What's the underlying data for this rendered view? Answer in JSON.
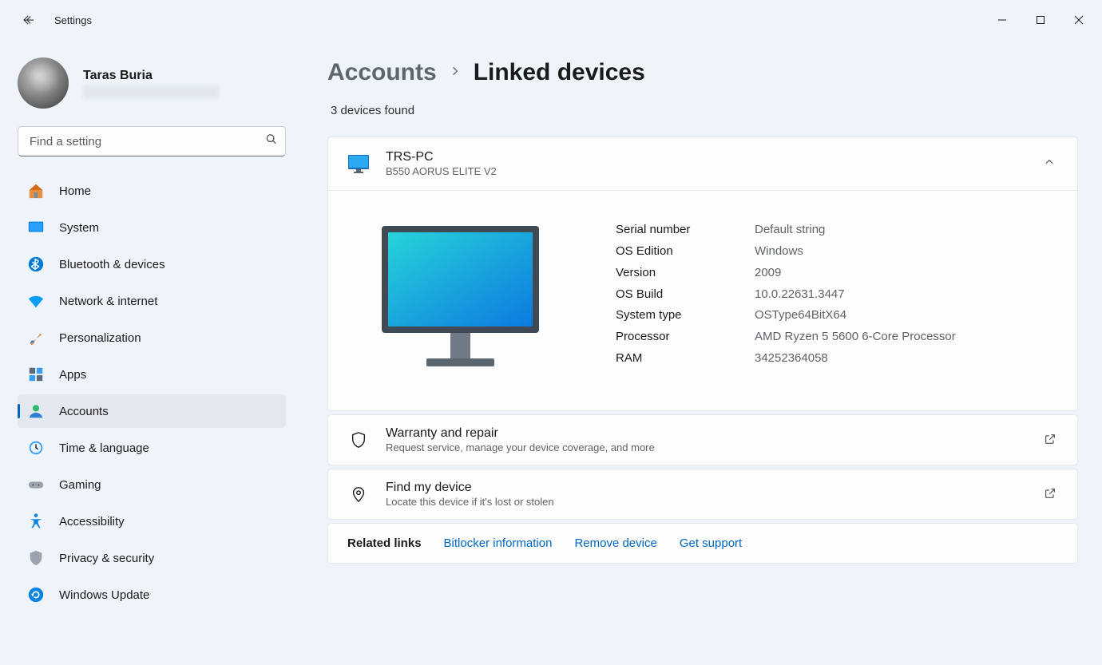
{
  "titlebar": {
    "title": "Settings"
  },
  "profile": {
    "name": "Taras Buria"
  },
  "search": {
    "placeholder": "Find a setting"
  },
  "nav": {
    "items": [
      {
        "label": "Home",
        "icon": "home"
      },
      {
        "label": "System",
        "icon": "system"
      },
      {
        "label": "Bluetooth & devices",
        "icon": "bluetooth"
      },
      {
        "label": "Network & internet",
        "icon": "wifi"
      },
      {
        "label": "Personalization",
        "icon": "brush"
      },
      {
        "label": "Apps",
        "icon": "apps"
      },
      {
        "label": "Accounts",
        "icon": "accounts"
      },
      {
        "label": "Time & language",
        "icon": "time"
      },
      {
        "label": "Gaming",
        "icon": "gaming"
      },
      {
        "label": "Accessibility",
        "icon": "accessibility"
      },
      {
        "label": "Privacy & security",
        "icon": "privacy"
      },
      {
        "label": "Windows Update",
        "icon": "update"
      }
    ]
  },
  "breadcrumb": {
    "parent": "Accounts",
    "current": "Linked devices"
  },
  "devices_found": "3 devices found",
  "device": {
    "name": "TRS-PC",
    "model": "B550 AORUS ELITE V2",
    "specs": {
      "serial_label": "Serial number",
      "serial_value": "Default string",
      "os_edition_label": "OS Edition",
      "os_edition_value": "Windows",
      "version_label": "Version",
      "version_value": "2009",
      "os_build_label": "OS Build",
      "os_build_value": "10.0.22631.3447",
      "system_type_label": "System type",
      "system_type_value": "OSType64BitX64",
      "processor_label": "Processor",
      "processor_value": "AMD Ryzen 5 5600 6-Core Processor",
      "ram_label": "RAM",
      "ram_value": "34252364058"
    }
  },
  "links": {
    "warranty_title": "Warranty and repair",
    "warranty_sub": "Request service, manage your device coverage, and more",
    "find_title": "Find my device",
    "find_sub": "Locate this device if it's lost or stolen"
  },
  "related": {
    "label": "Related links",
    "bitlocker": "Bitlocker information",
    "remove": "Remove device",
    "support": "Get support"
  }
}
